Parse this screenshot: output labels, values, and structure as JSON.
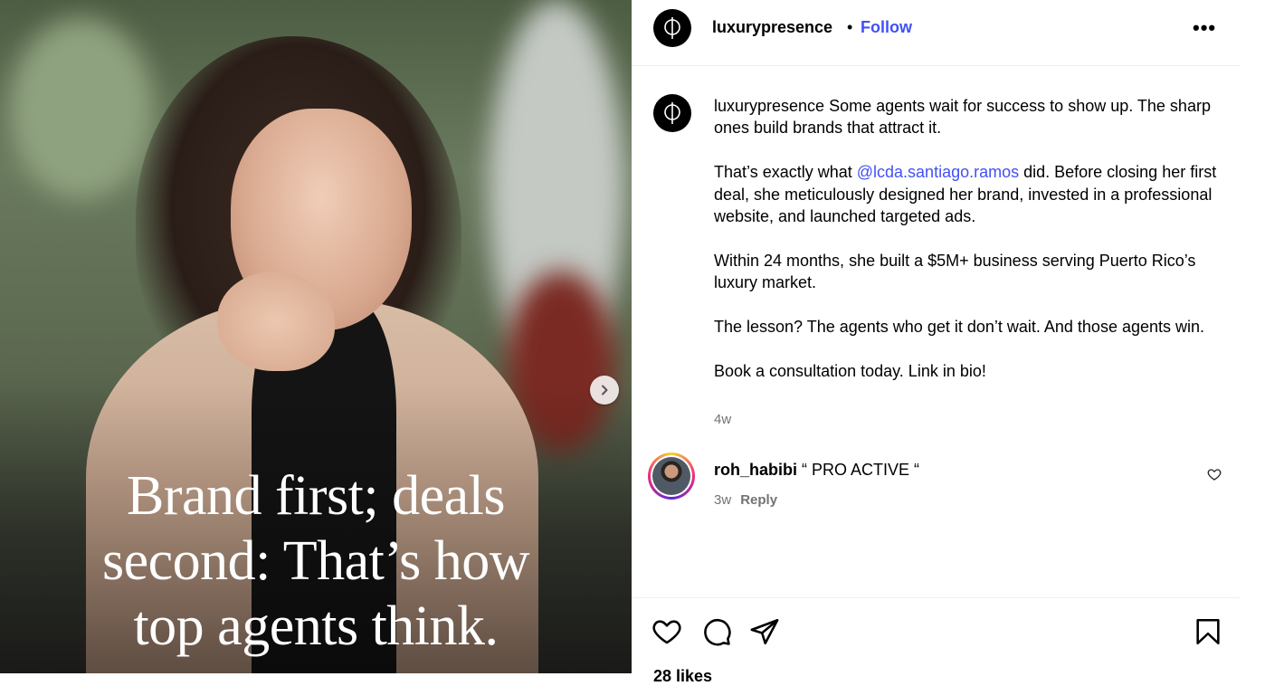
{
  "post": {
    "image_caption_lines": [
      "Brand first; deals",
      "second: That’s how",
      "top agents think."
    ],
    "next_icon": "chevron-right-icon"
  },
  "header": {
    "username": "luxurypresence",
    "separator": "•",
    "follow_label": "Follow",
    "more_label": "•••"
  },
  "caption": {
    "username": "luxurypresence",
    "p1": "Some agents wait for success to show up. The sharp ones build brands that attract it.",
    "p2_before": "That’s exactly what ",
    "p2_mention": "@lcda.santiago.ramos",
    "p2_after": " did. Before closing her first deal, she meticulously designed her brand, invested in a professional website, and launched targeted ads.",
    "p3": "Within 24 months, she built a $5M+ business serving Puerto Rico’s luxury market.",
    "p4": "The lesson? The agents who get it don’t wait. And those agents win.",
    "p5": "Book a consultation today. Link in bio!",
    "time": "4w"
  },
  "comment": {
    "username": "roh_habibi",
    "text": " “ PRO ACTIVE “",
    "time": "3w",
    "reply_label": "Reply"
  },
  "actions": {
    "icons": [
      "heart-icon",
      "comment-icon",
      "share-icon",
      "bookmark-icon"
    ],
    "likes": "28 likes"
  },
  "colors": {
    "link": "#4150f7",
    "muted": "#737373"
  }
}
